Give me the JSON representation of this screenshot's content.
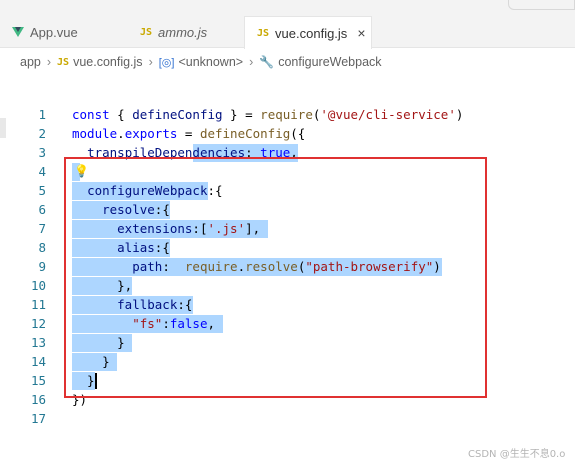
{
  "tabs": [
    {
      "label": "App.vue",
      "icon": "vue-icon"
    },
    {
      "label": "ammo.js",
      "icon": "js-icon",
      "icon_text": "JS"
    },
    {
      "label": "vue.config.js",
      "icon": "js-icon",
      "icon_text": "JS",
      "active": true,
      "close": "×"
    }
  ],
  "breadcrumb": {
    "folder": "app",
    "file": "vue.config.js",
    "file_icon": "JS",
    "symbol": "<unknown>",
    "symbol_icon": "[◎]",
    "method": "configureWebpack"
  },
  "editor": {
    "lines": [
      {
        "n": "1",
        "tokens": [
          [
            "k",
            "const"
          ],
          [
            "d",
            " { "
          ],
          [
            "p",
            "defineConfig"
          ],
          [
            "d",
            " } = "
          ],
          [
            "f",
            "require"
          ],
          [
            "d",
            "("
          ],
          [
            "s",
            "'@vue/cli-service'"
          ],
          [
            "d",
            ")"
          ]
        ]
      },
      {
        "n": "2",
        "tokens": [
          [
            "k",
            "module"
          ],
          [
            "d",
            "."
          ],
          [
            "k",
            "exports"
          ],
          [
            "d",
            " = "
          ],
          [
            "f",
            "defineConfig"
          ],
          [
            "d",
            "({"
          ]
        ]
      },
      {
        "n": "3",
        "tokens": [
          [
            "d",
            "  "
          ],
          [
            "p",
            "transpileDependencies"
          ],
          [
            "d",
            ": "
          ],
          [
            "k",
            "true"
          ],
          [
            "d",
            ","
          ]
        ]
      },
      {
        "n": "4",
        "tokens": []
      },
      {
        "n": "5",
        "tokens": [
          [
            "d",
            "  "
          ],
          [
            "p",
            "configureWebpack"
          ],
          [
            "d",
            ":{"
          ]
        ]
      },
      {
        "n": "6",
        "tokens": [
          [
            "d",
            "    "
          ],
          [
            "p",
            "resolve"
          ],
          [
            "d",
            ":{"
          ]
        ]
      },
      {
        "n": "7",
        "tokens": [
          [
            "d",
            "      "
          ],
          [
            "p",
            "extensions"
          ],
          [
            "d",
            ":["
          ],
          [
            "s",
            "'.js'"
          ],
          [
            "d",
            "],"
          ]
        ]
      },
      {
        "n": "8",
        "tokens": [
          [
            "d",
            "      "
          ],
          [
            "p",
            "alias"
          ],
          [
            "d",
            ":{"
          ]
        ]
      },
      {
        "n": "9",
        "tokens": [
          [
            "d",
            "        "
          ],
          [
            "p",
            "path"
          ],
          [
            "d",
            ":  "
          ],
          [
            "f",
            "require"
          ],
          [
            "d",
            "."
          ],
          [
            "f",
            "resolve"
          ],
          [
            "d",
            "("
          ],
          [
            "s",
            "\"path-browserify\""
          ],
          [
            "d",
            ")"
          ]
        ]
      },
      {
        "n": "10",
        "tokens": [
          [
            "d",
            "      },"
          ]
        ]
      },
      {
        "n": "11",
        "tokens": [
          [
            "d",
            "      "
          ],
          [
            "p",
            "fallback"
          ],
          [
            "d",
            ":{"
          ]
        ]
      },
      {
        "n": "12",
        "tokens": [
          [
            "d",
            "        "
          ],
          [
            "s",
            "\"fs\""
          ],
          [
            "d",
            ":"
          ],
          [
            "k",
            "false"
          ],
          [
            "d",
            ","
          ]
        ]
      },
      {
        "n": "13",
        "tokens": [
          [
            "d",
            "      }"
          ]
        ]
      },
      {
        "n": "14",
        "tokens": [
          [
            "d",
            "    }"
          ]
        ]
      },
      {
        "n": "15",
        "tokens": [
          [
            "d",
            "  }"
          ]
        ]
      },
      {
        "n": "16",
        "tokens": [
          [
            "d",
            "})"
          ]
        ]
      },
      {
        "n": "17",
        "tokens": []
      }
    ]
  },
  "watermark": "CSDN @生生不息0.o",
  "colors": {
    "selection": "#add6ff",
    "highlight_box": "#e03131",
    "line_numbers": "#237893"
  }
}
